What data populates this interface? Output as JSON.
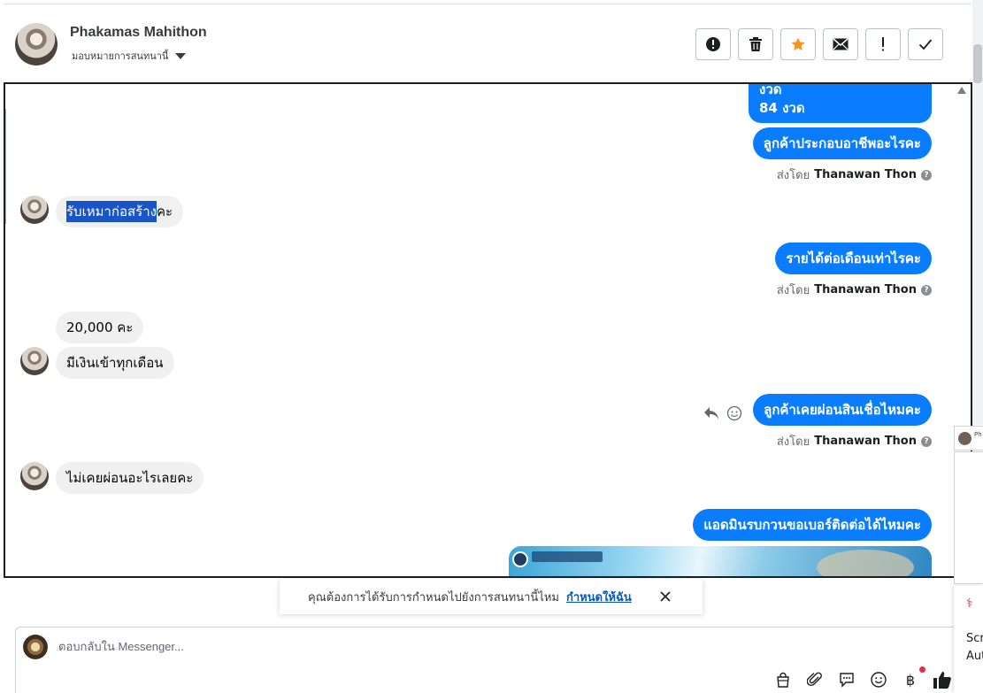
{
  "header": {
    "contact_name": "Phakamas Mahithon",
    "assign_label": "มอบหมายการสนทนานี้"
  },
  "toolbar": [
    {
      "name": "report-spam-button",
      "icon": "alert-circle-icon"
    },
    {
      "name": "delete-button",
      "icon": "trash-icon"
    },
    {
      "name": "star-button",
      "icon": "star-icon"
    },
    {
      "name": "mark-unread-button",
      "icon": "mail-icon"
    },
    {
      "name": "follow-up-button",
      "icon": "exclamation-icon"
    },
    {
      "name": "mark-done-button",
      "icon": "check-icon"
    }
  ],
  "thread": {
    "top_partial_lines": [
      "งวด",
      "84 งวด"
    ],
    "messages": [
      {
        "type": "out",
        "text": "ลูกค้าประกอบอาชีพอะไรคะ",
        "sent_by_prefix": "ส่งโดย",
        "sent_by": "Thanawan Thon"
      },
      {
        "type": "in",
        "highlighted": "รับเหมาก่อสร้าง",
        "text": "คะ"
      },
      {
        "type": "out",
        "text": "รายได้ต่อเดือนเท่าไรคะ",
        "sent_by_prefix": "ส่งโดย",
        "sent_by": "Thanawan Thon"
      },
      {
        "type": "in",
        "text": "20,000 คะ"
      },
      {
        "type": "in",
        "text": "มีเงินเข้าทุกเดือน"
      },
      {
        "type": "out",
        "text": "ลูกค้าเคยผ่อนสินเชื่อไหมคะ",
        "sent_by_prefix": "ส่งโดย",
        "sent_by": "Thanawan Thon"
      },
      {
        "type": "in",
        "text": "ไม่เคยผ่อนอะไรเลยคะ"
      },
      {
        "type": "out",
        "text": "แอดมินรบกวนขอเบอร์ติดต่อได้ไหมคะ"
      }
    ]
  },
  "toast": {
    "text": "คุณต้องการได้รับการกำหนดไปยังการสนทนานี้ไหม",
    "link": "กำหนดให้ฉัน"
  },
  "composer": {
    "placeholder": "ตอบกลับใน Messenger...",
    "tools": [
      "shopping-bag-icon",
      "paperclip-icon",
      "saved-reply-icon",
      "emoji-icon",
      "baht-payment-icon",
      "like-icon"
    ],
    "baht_symbol": "฿"
  },
  "side": {
    "panel_text_1": "Scr",
    "panel_text_2": "Aut",
    "chip_text": "Ph"
  },
  "colors": {
    "accent": "#0a7cff",
    "star": "#f7931e",
    "highlight": "#1a55c7",
    "notification": "#f02849"
  }
}
